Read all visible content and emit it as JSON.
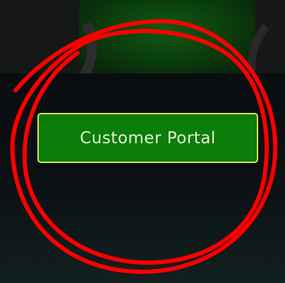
{
  "portal_button": {
    "label": "Customer Portal"
  },
  "colors": {
    "button_fill": "#0a7d0a",
    "button_border": "#d8e45a",
    "annotation": "#ff0000"
  }
}
